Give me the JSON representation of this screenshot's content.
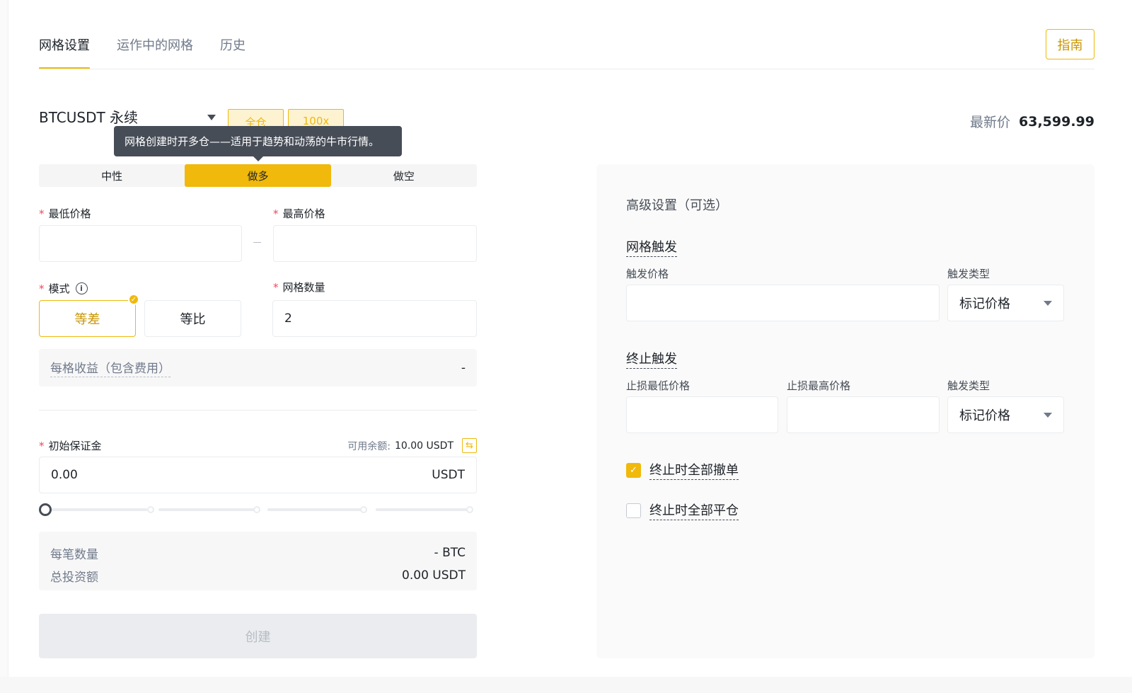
{
  "tabs": [
    {
      "label": "网格设置",
      "active": true
    },
    {
      "label": "运作中的网格",
      "active": false
    },
    {
      "label": "历史",
      "active": false
    }
  ],
  "guide_label": "指南",
  "symbol": {
    "name": "BTCUSDT 永续",
    "margin_mode": "全仓",
    "leverage": "100x"
  },
  "tooltip": "网格创建时开多仓——适用于趋势和动荡的牛市行情。",
  "last_price": {
    "label": "最新价",
    "value": "63,599.99"
  },
  "direction": {
    "options": [
      "中性",
      "做多",
      "做空"
    ],
    "selected": "做多"
  },
  "form": {
    "min_price_label": "最低价格",
    "max_price_label": "最高价格",
    "min_price_value": "",
    "max_price_value": "",
    "mode_label": "模式",
    "mode_options": [
      "等差",
      "等比"
    ],
    "mode_selected": "等差",
    "grid_count_label": "网格数量",
    "grid_count_value": "2",
    "profit_label": "每格收益（包含费用）",
    "profit_value": "-",
    "margin_label": "初始保证金",
    "available_label": "可用余额:",
    "available_value": "10.00 USDT",
    "margin_value": "0.00",
    "margin_unit": "USDT",
    "slider_percent": 0,
    "per_order_label": "每笔数量",
    "per_order_value": "- BTC",
    "total_invest_label": "总投资额",
    "total_invest_value": "0.00 USDT",
    "create_label": "创建"
  },
  "advanced": {
    "title": "高级设置（可选）",
    "grid_trigger_title": "网格触发",
    "trigger_price_label": "触发价格",
    "trigger_price_value": "",
    "trigger_type_label": "触发类型",
    "trigger_type_value": "标记价格",
    "stop_trigger_title": "终止触发",
    "stop_low_label": "止损最低价格",
    "stop_low_value": "",
    "stop_high_label": "止损最高价格",
    "stop_high_value": "",
    "stop_type_label": "触发类型",
    "stop_type_value": "标记价格",
    "cancel_all_label": "终止时全部撤单",
    "cancel_all_checked": true,
    "close_all_label": "终止时全部平仓",
    "close_all_checked": false
  },
  "colors": {
    "accent": "#f0b90b",
    "accent_text": "#c99400",
    "required": "#f6465d",
    "tooltip_bg": "#474d57"
  },
  "icons": {
    "symbol_dropdown": "caret-down-icon",
    "mode_info": "info-icon",
    "mode_selected": "check-badge-icon",
    "transfer": "transfer-icon",
    "select_dropdown": "caret-down-icon",
    "checkbox_checked": "check-icon"
  }
}
